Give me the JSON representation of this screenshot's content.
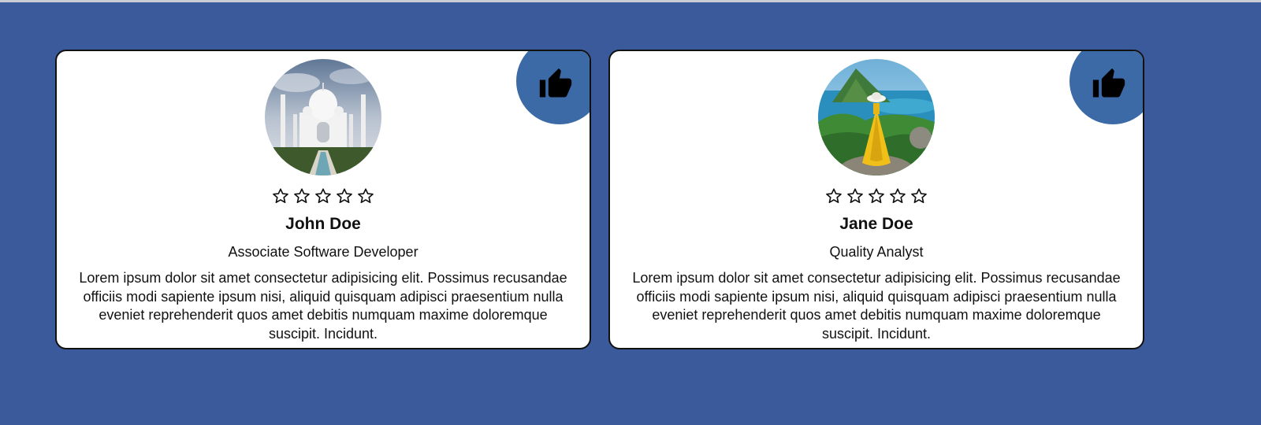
{
  "cards": [
    {
      "name": "John Doe",
      "role": "Associate Software Developer",
      "description": "Lorem ipsum dolor sit amet consectetur adipisicing elit. Possimus recusandae officiis modi sapiente ipsum nisi, aliquid quisquam adipisci praesentium nulla eveniet reprehenderit quos amet debitis numquam maxime doloremque suscipit. Incidunt.",
      "rating": 0,
      "max_rating": 5,
      "avatar_icon": "taj-mahal-photo",
      "badge_icon": "thumbs-up-icon"
    },
    {
      "name": "Jane Doe",
      "role": "Quality Analyst",
      "description": "Lorem ipsum dolor sit amet consectetur adipisicing elit. Possimus recusandae officiis modi sapiente ipsum nisi, aliquid quisquam adipisci praesentium nulla eveniet reprehenderit quos amet debitis numquam maxime doloremque suscipit. Incidunt.",
      "rating": 0,
      "max_rating": 5,
      "avatar_icon": "coastal-landscape-photo",
      "badge_icon": "thumbs-up-icon"
    }
  ],
  "colors": {
    "page_background": "#3a5a9b",
    "badge_background": "#3c6aa6",
    "card_background": "#ffffff",
    "text": "#111111"
  }
}
